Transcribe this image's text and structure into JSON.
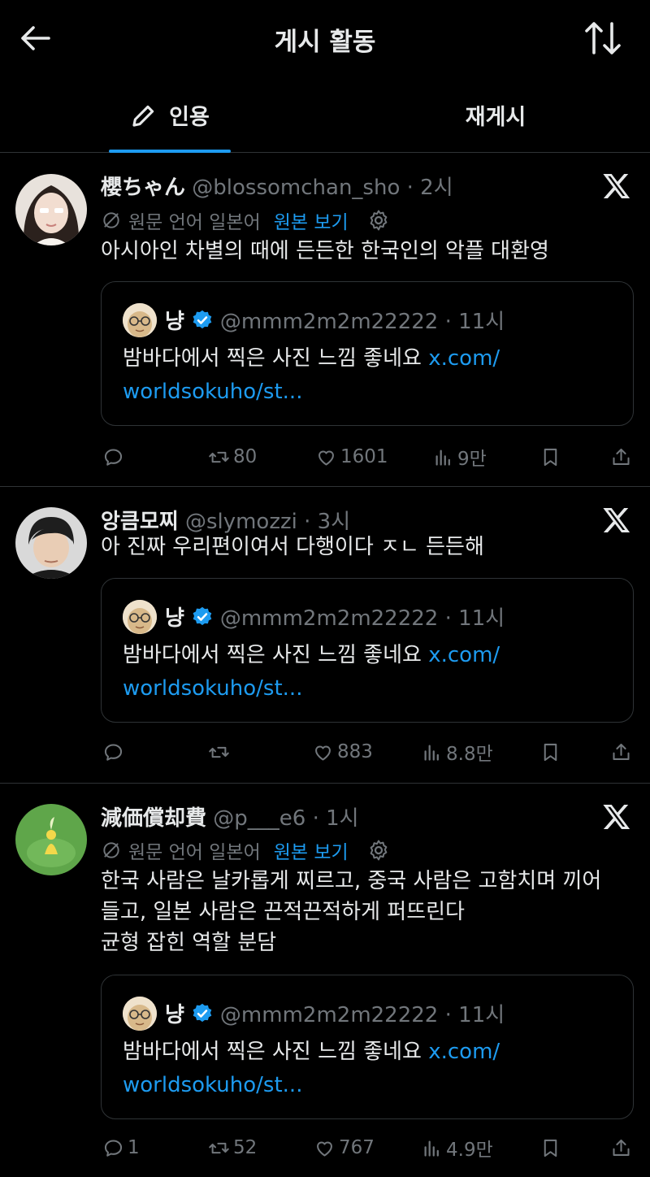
{
  "header": {
    "title": "게시 활동"
  },
  "tabs": [
    {
      "label": "인용",
      "active": true
    },
    {
      "label": "재게시",
      "active": false
    }
  ],
  "colors": {
    "background": "#000000",
    "accent": "#1d9bf0",
    "text": "#e7e9ea",
    "muted": "#71767b",
    "divider": "#2f3336"
  },
  "quoted": {
    "name": "냥",
    "meta": "@mmm2m2m22222 · 11시",
    "text": "밤바다에서 찍은 사진 느낌 좋네요 ",
    "link_line1": "x.com/",
    "link_line2": "worldsokuho/st..."
  },
  "posts": [
    {
      "name": "櫻ちゃん",
      "meta": "@blossomchan_sho · 2시",
      "translate": {
        "lang_label": "원문 언어 일본어",
        "original_label": "원본 보기"
      },
      "text": "아시아인 차별의 때에 든든한 한국인의 악플 대환영",
      "actions": {
        "replies": "",
        "reposts": "80",
        "likes": "1601",
        "views": "9만"
      }
    },
    {
      "name": "앙큼모찌",
      "meta": "@slymozzi · 3시",
      "text": "아 진짜 우리편이여서 다행이다 ㅈㄴ 든든해",
      "actions": {
        "replies": "",
        "reposts": "",
        "likes": "883",
        "views": "8.8만"
      }
    },
    {
      "name": "減価償却費",
      "meta": "@p___e6 · 1시",
      "translate": {
        "lang_label": "원문 언어 일본어",
        "original_label": "원본 보기"
      },
      "text": "한국 사람은 날카롭게 찌르고, 중국 사람은 고함치며 끼어\n들고, 일본 사람은 끈적끈적하게 퍼뜨린다\n균형 잡힌 역할 분담",
      "actions": {
        "replies": "1",
        "reposts": "52",
        "likes": "767",
        "views": "4.9만"
      }
    }
  ]
}
